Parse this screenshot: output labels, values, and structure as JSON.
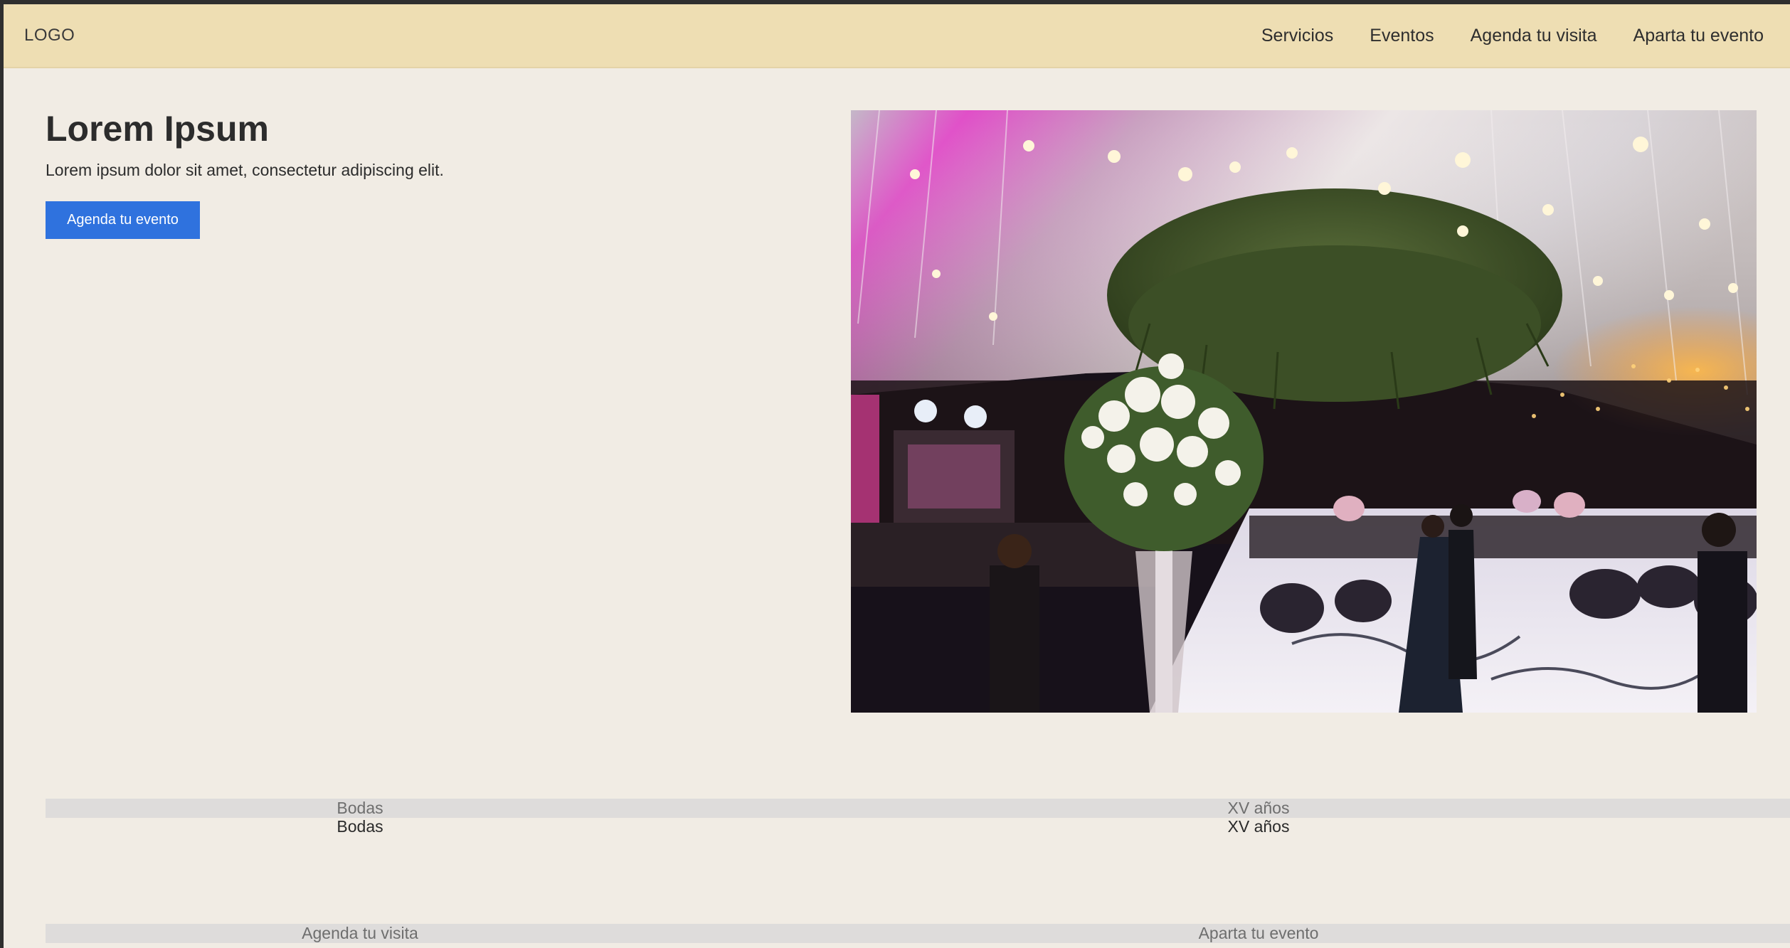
{
  "nav": {
    "logo": "LOGO",
    "links": [
      "Servicios",
      "Eventos",
      "Agenda tu visita",
      "Aparta tu evento"
    ]
  },
  "hero": {
    "title": "Lorem Ipsum",
    "subtitle": "Lorem ipsum dolor sit amet, consectetur adipiscing elit.",
    "cta": "Agenda tu evento",
    "image": "event-photo"
  },
  "categories": {
    "tab_labels": [
      "Bodas",
      "XV años"
    ],
    "labels": [
      "Bodas",
      "XV años"
    ]
  },
  "actions": {
    "labels": [
      "Agenda tu visita",
      "Aparta tu evento"
    ]
  },
  "colors": {
    "page_bg": "#f1ece4",
    "nav_bg": "#eedeb3",
    "cta_bg": "#2f72de",
    "strip_bg": "#dedcdb"
  }
}
